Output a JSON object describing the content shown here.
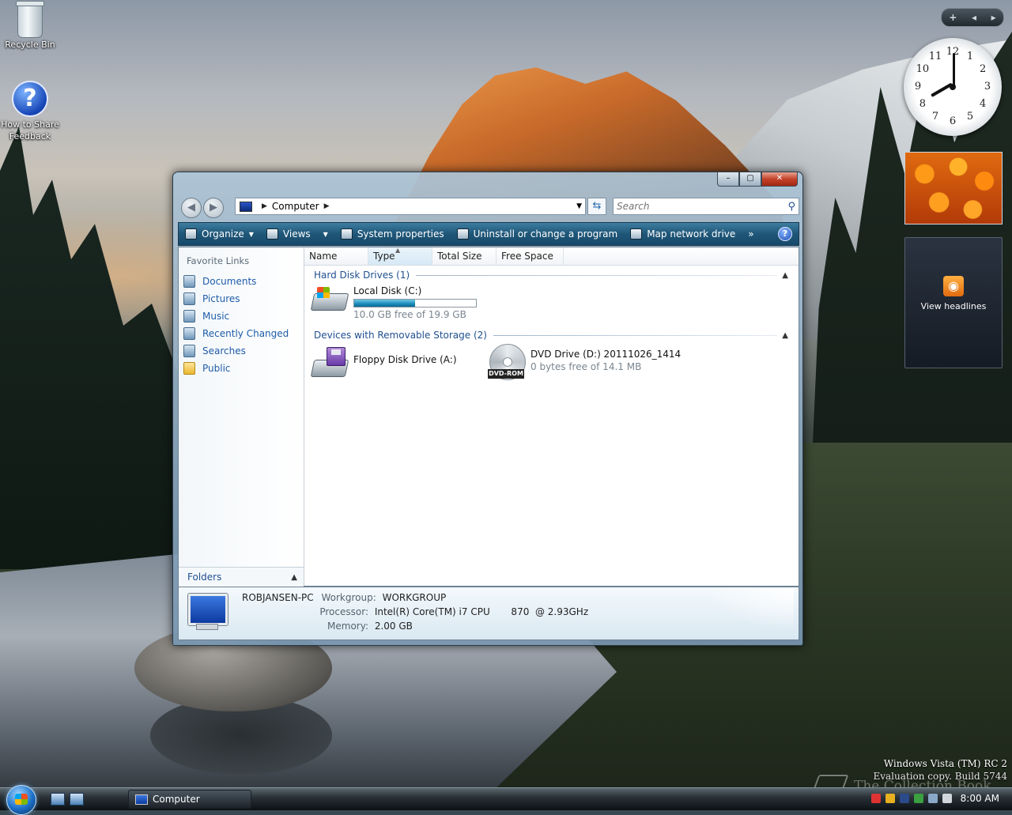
{
  "desktop": {
    "icons": [
      {
        "label": "Recycle Bin"
      },
      {
        "label": "How to Share Feedback"
      }
    ]
  },
  "gadgets": {
    "toolbar": {
      "add": "+",
      "prev": "◂",
      "next": "▸"
    },
    "clock": {
      "hour": 8,
      "minute": 0,
      "numbers": [
        "12",
        "1",
        "2",
        "3",
        "4",
        "5",
        "6",
        "7",
        "8",
        "9",
        "10",
        "11"
      ]
    },
    "feed": {
      "label": "View headlines"
    }
  },
  "window": {
    "controls": {
      "minimize": "–",
      "maximize": "▢",
      "close": "✕"
    },
    "address": {
      "location": "Computer"
    },
    "search": {
      "placeholder": "Search"
    },
    "toolbar": {
      "items": [
        "Organize",
        "Views",
        "System properties",
        "Uninstall or change a program",
        "Map network drive"
      ],
      "more": "»",
      "help": "?"
    },
    "nav": {
      "heading": "Favorite Links",
      "links": [
        "Documents",
        "Pictures",
        "Music",
        "Recently Changed",
        "Searches",
        "Public"
      ],
      "folders": "Folders"
    },
    "columns": [
      "Name",
      "Type",
      "Total Size",
      "Free Space"
    ],
    "groups": {
      "hard_disks": "Hard Disk Drives (1)",
      "removable": "Devices with Removable Storage (2)"
    },
    "drives": {
      "local": {
        "name": "Local Disk (C:)",
        "free": "10.0 GB free of 19.9 GB",
        "used_fraction": 0.5
      },
      "floppy": {
        "name": "Floppy Disk Drive (A:)"
      },
      "dvd": {
        "name": "DVD Drive (D:) 20111026_1414",
        "free": "0 bytes free of 14.1 MB",
        "badge": "DVD-ROM"
      }
    },
    "details": {
      "computer_name": "ROBJANSEN-PC",
      "workgroup_label": "Workgroup:",
      "workgroup": "WORKGROUP",
      "processor_label": "Processor:",
      "processor": "Intel(R) Core(TM) i7 CPU       870  @ 2.93GHz",
      "memory_label": "Memory:",
      "memory": "2.00 GB"
    }
  },
  "watermark": {
    "line1": "Windows Vista (TM) RC 2",
    "line2": "Evaluation copy. Build 5744",
    "brand": "The Collection Book"
  },
  "taskbar": {
    "window_button": "Computer",
    "time": "8:00 AM"
  },
  "colors": {
    "accent": "#1f5ca8",
    "toolbar": "#1f5678",
    "capacity_fill": "#1a8ab8"
  }
}
